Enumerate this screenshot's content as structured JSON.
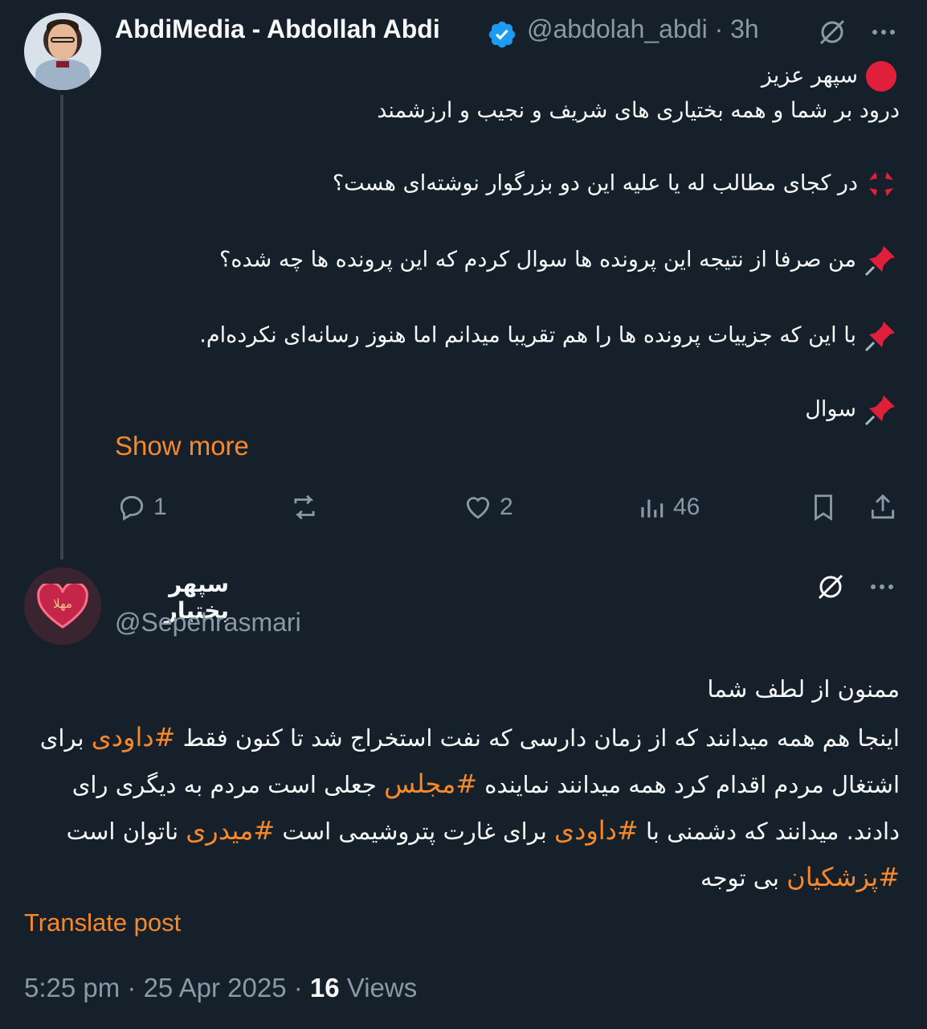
{
  "post1": {
    "author_name": "AbdiMedia - Abdollah Abdi",
    "handle": "@abdolah_abdi",
    "time": "· 3h",
    "lines": [
      "سپهر عزیز",
      "درود بر شما و همه بختیاری های شریف و نجیب و ارزشمند",
      "در کجای مطالب له یا علیه این دو بزرگوار نوشته‌ای هست؟",
      "من صرفا از نتیجه این پرونده ها سوال کردم که این پرونده ها چه شده؟",
      "با این که جزییات پرونده ها را هم تقریبا میدانم اما هنوز رسانه‌ای نکرده‌ام.",
      "سوال"
    ],
    "show_more": "Show more",
    "replies": "1",
    "likes": "2",
    "views": "46"
  },
  "post2": {
    "author_name": "سپهر بختیار",
    "handle": "@Sepehrasmari",
    "avatar_text": "مهلا",
    "line1": "ممنون از لطف شما",
    "line2_before": "اینجا هم همه میدانند که از زمان دارسی که نفت استخراج شد تا کنون فقط ",
    "tag_davoodi": "#داودی",
    "line2_after": " برای",
    "line3_before": "اشتغال مردم اقدام کرد همه میدانند نماینده ",
    "tag_majles": "#مجلس",
    "line3_after": " جعلی است مردم به دیگری رای",
    "line4_before": "دادند. میدانند که دشمنی با ",
    "tag_davoodi2": "#داودی",
    "line4_mid": " برای غارت پتروشیمی است ",
    "tag_meydari": "#میدری",
    "line4_after": " ناتوان است",
    "tag_pezeshkian": "#پزشکیان",
    "line5_after": " بی توجه",
    "translate": "Translate post",
    "timestamp": "5:25 pm · 25 Apr 2025 · ",
    "views_count": "16",
    "views_label": " Views"
  },
  "colors": {
    "accent": "#f7892a",
    "background": "#15202b",
    "muted": "#8b98a5",
    "verified": "#1d9bf0"
  }
}
